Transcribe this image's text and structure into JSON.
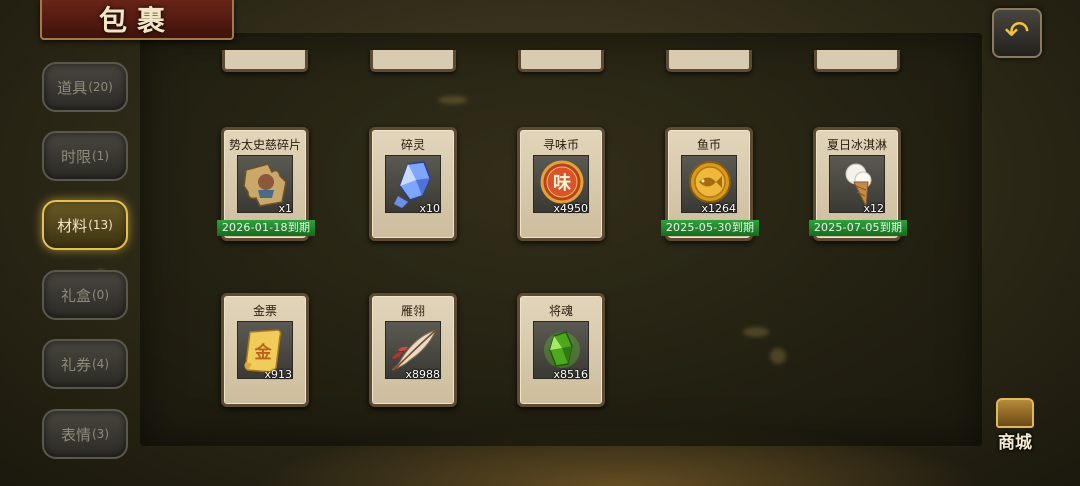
{
  "header": {
    "title": "包裹"
  },
  "sidebar": {
    "tabs": [
      {
        "label": "道具",
        "count": "(20)",
        "active": false
      },
      {
        "label": "时限",
        "count": "(1)",
        "active": false
      },
      {
        "label": "材料",
        "count": "(13)",
        "active": true
      },
      {
        "label": "礼盒",
        "count": "(0)",
        "active": false
      },
      {
        "label": "礼券",
        "count": "(4)",
        "active": false
      },
      {
        "label": "表情",
        "count": "(3)",
        "active": false
      }
    ]
  },
  "items": [
    {
      "name": "势太史慈碎片",
      "qty": "x1",
      "expiry": "2026-01-18到期",
      "icon": "puzzle-piece-icon"
    },
    {
      "name": "碎灵",
      "qty": "x10",
      "expiry": "",
      "icon": "crystal-icon"
    },
    {
      "name": "寻味币",
      "qty": "x4950",
      "expiry": "",
      "icon": "taste-coin-icon"
    },
    {
      "name": "鱼币",
      "qty": "x1264",
      "expiry": "2025-05-30到期",
      "icon": "fish-coin-icon"
    },
    {
      "name": "夏日冰淇淋",
      "qty": "x12",
      "expiry": "2025-07-05到期",
      "icon": "ice-cream-icon"
    },
    {
      "name": "金票",
      "qty": "x913",
      "expiry": "",
      "icon": "gold-ticket-icon"
    },
    {
      "name": "雁翎",
      "qty": "x8988",
      "expiry": "",
      "icon": "feather-icon"
    },
    {
      "name": "将魂",
      "qty": "x8516",
      "expiry": "",
      "icon": "general-soul-icon"
    }
  ],
  "icon_glyphs": {
    "taste_coin": "味",
    "gold_ticket": "金"
  },
  "shop": {
    "label": "商城"
  },
  "back": {
    "icon": "back-arrow-icon",
    "glyph": "↶"
  }
}
